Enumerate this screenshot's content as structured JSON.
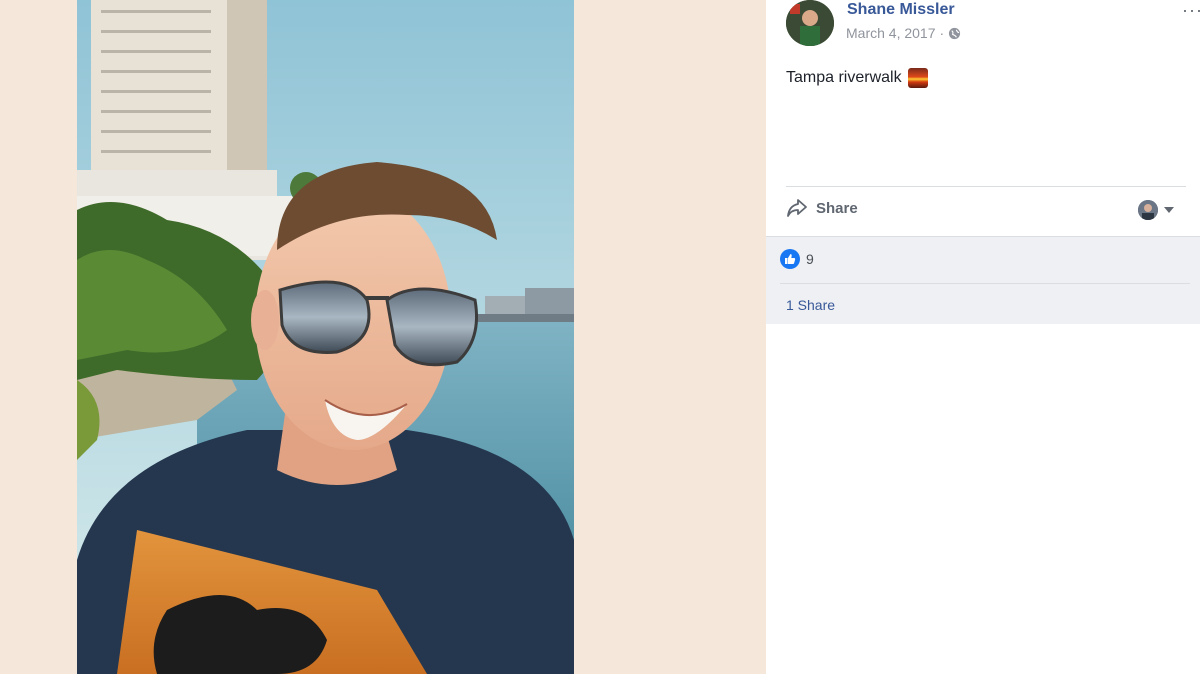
{
  "post": {
    "author": "Shane Missler",
    "date": "March 4, 2017",
    "separator": "·",
    "text": "Tampa riverwalk",
    "emoji_icon": "sunset-emoji-icon",
    "more_label": "···"
  },
  "actions": {
    "share_label": "Share",
    "share_icon": "share-arrow-icon",
    "viewer_icon": "viewer-avatar-icon"
  },
  "feedback": {
    "reaction_icon": "like-icon",
    "reaction_count": "9",
    "shares_label": "1 Share"
  },
  "colors": {
    "author_link": "#385898",
    "like_blue": "#1877f2",
    "page_background": "#f5e7d9",
    "feedback_background": "#eef0f3"
  }
}
